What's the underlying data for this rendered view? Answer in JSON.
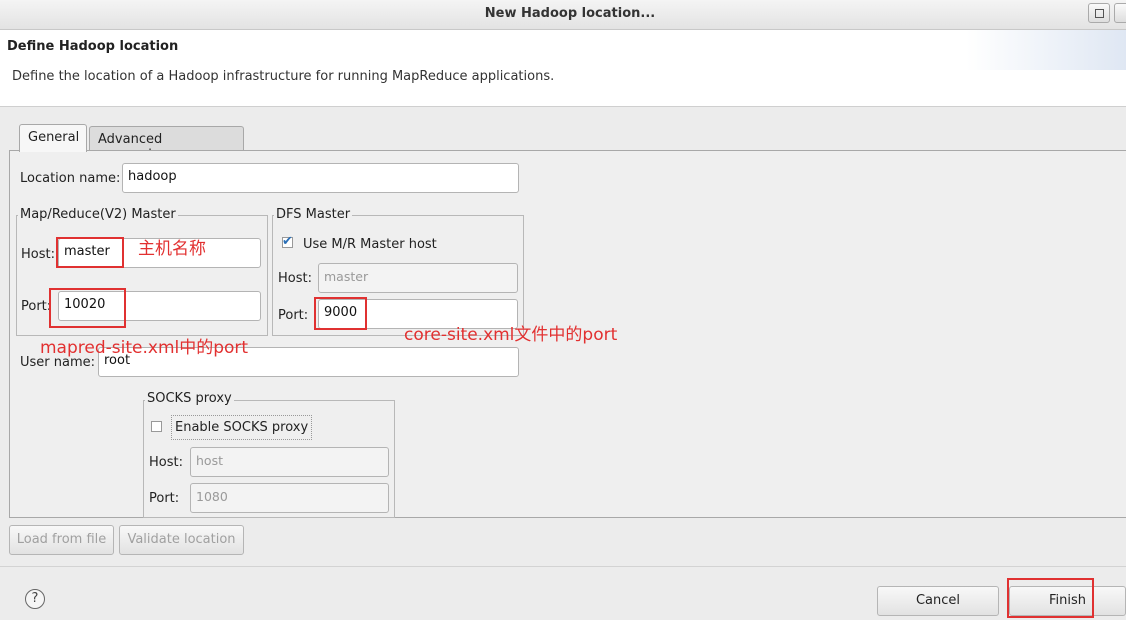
{
  "window": {
    "title": "New Hadoop location..."
  },
  "banner": {
    "title": "Define Hadoop location",
    "description": "Define the location of a Hadoop infrastructure for running MapReduce applications."
  },
  "tabs": {
    "general": "General",
    "advanced": "Advanced parameters"
  },
  "form": {
    "location_label": "Location name:",
    "location_value": "hadoop",
    "mr_master": {
      "title": "Map/Reduce(V2) Master",
      "host_label": "Host:",
      "host_value": "master",
      "port_label": "Port:",
      "port_value": "10020"
    },
    "dfs_master": {
      "title": "DFS Master",
      "use_mr_label": "Use M/R Master host",
      "use_mr_checked": true,
      "host_label": "Host:",
      "host_value": "master",
      "port_label": "Port:",
      "port_value": "9000"
    },
    "user_label": "User name:",
    "user_value": "root",
    "socks": {
      "title": "SOCKS proxy",
      "enable_label": "Enable SOCKS proxy",
      "enable_checked": false,
      "host_label": "Host:",
      "host_value": "host",
      "port_label": "Port:",
      "port_value": "1080"
    }
  },
  "buttons": {
    "load_from_file": "Load from file",
    "validate": "Validate location",
    "cancel": "Cancel",
    "finish": "Finish",
    "help": "?"
  },
  "annotations": {
    "host_note": "主机名称",
    "mapred_note": "mapred-site.xml中的port",
    "core_note": "core-site.xml文件中的port"
  },
  "colors": {
    "annotation": "#e23030",
    "checkmark": "#2a6fb6"
  }
}
